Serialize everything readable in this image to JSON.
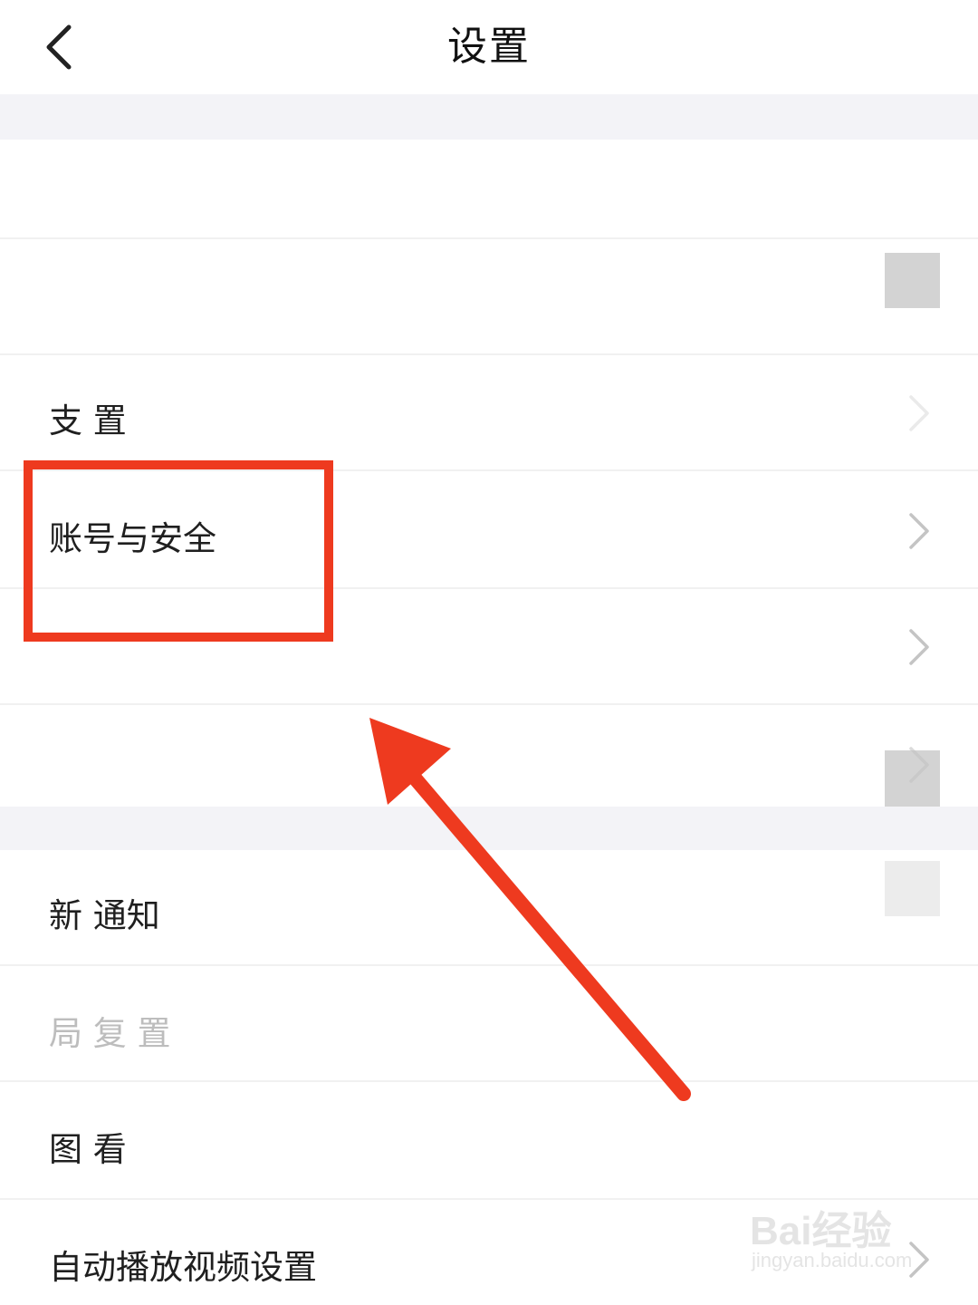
{
  "header": {
    "title": "设置",
    "back_icon": "chevron-left-icon"
  },
  "rows": [
    {
      "label": "",
      "chevron": false
    },
    {
      "label": "",
      "chevron": false
    },
    {
      "label": "支    置",
      "chevron": true
    },
    {
      "label": "账号与安全",
      "chevron": true
    },
    {
      "label": "",
      "chevron": true
    },
    {
      "label": "",
      "chevron": true
    },
    {
      "label": "新     通知",
      "chevron": false
    },
    {
      "label": " 局      复 置",
      "chevron": false
    },
    {
      "label": "图        看",
      "chevron": false
    },
    {
      "label": "自动播放视频设置",
      "chevron": true
    }
  ],
  "annotation": {
    "box_color": "#ee3a1f",
    "arrow_color": "#ee3a1f"
  },
  "watermark": {
    "brand": "Bai经验",
    "url": "jingyan.baidu.com"
  },
  "colors": {
    "background": "#ffffff",
    "section_gap": "#f3f3f7",
    "chevron": "#c4c4c4",
    "text": "#1f1f1f"
  }
}
